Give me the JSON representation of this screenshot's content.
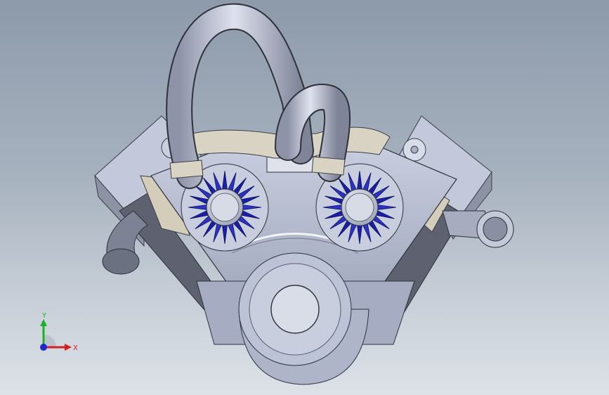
{
  "viewport": {
    "background_top": "#8d9aaa",
    "background_bottom": "#dde2e8"
  },
  "model": {
    "description_icon": "v-engine-assembly",
    "body_color": "#b9c0d3",
    "shadow_color": "#6f7585",
    "impeller_color": "#1a1fa8",
    "pipe_color": "#aeb3c8",
    "gasket_color": "#d9d3c3"
  },
  "triad": {
    "x_label": "X",
    "y_label": "Y",
    "x_color": "#d32020",
    "y_color": "#1fae2a",
    "z_color": "#1b2bd0"
  }
}
